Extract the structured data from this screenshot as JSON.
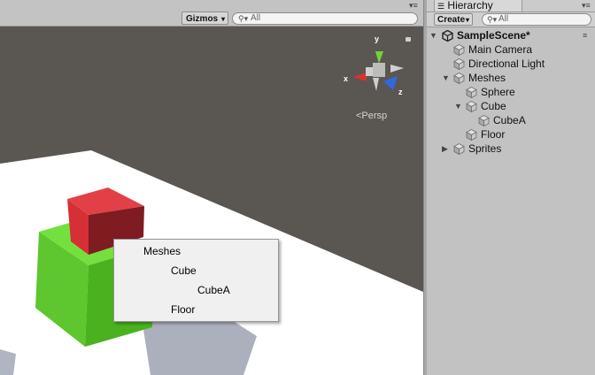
{
  "scene_view": {
    "toolbar": {
      "gizmos_label": "Gizmos",
      "search_placeholder": "All",
      "search_icon": "search-icon"
    },
    "orientation_gizmo": {
      "x_label": "x",
      "y_label": "y",
      "z_label": "z",
      "projection_label": "<Persp"
    },
    "context_menu": {
      "items": [
        "Meshes",
        "Cube",
        "CubeA",
        "Floor"
      ]
    }
  },
  "hierarchy": {
    "tab_label": "Hierarchy",
    "create_label": "Create",
    "search_placeholder": "All",
    "scene_name": "SampleScene*",
    "items": [
      {
        "label": "Main Camera",
        "depth": 1,
        "expander": "none"
      },
      {
        "label": "Directional Light",
        "depth": 1,
        "expander": "none"
      },
      {
        "label": "Meshes",
        "depth": 1,
        "expander": "expanded"
      },
      {
        "label": "Sphere",
        "depth": 2,
        "expander": "none"
      },
      {
        "label": "Cube",
        "depth": 2,
        "expander": "expanded"
      },
      {
        "label": "CubeA",
        "depth": 3,
        "expander": "none"
      },
      {
        "label": "Floor",
        "depth": 2,
        "expander": "none"
      },
      {
        "label": "Sprites",
        "depth": 1,
        "expander": "collapsed"
      }
    ]
  },
  "colors": {
    "green_cube": "#5fd130",
    "red_cube": "#d43636",
    "floor": "#ffffff",
    "background": "#5b5753"
  }
}
